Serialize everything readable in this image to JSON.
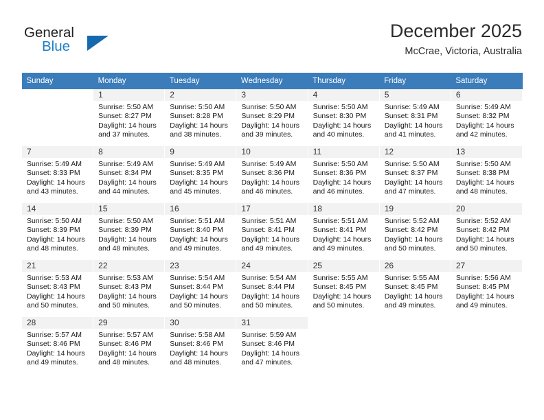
{
  "brand": {
    "name_part1": "General",
    "name_part2": "Blue",
    "triangle_color": "#1668b0",
    "blue_color": "#1d7fc4"
  },
  "header": {
    "month_title": "December 2025",
    "location": "McCrae, Victoria, Australia",
    "header_bg": "#3b7cba"
  },
  "calendar": {
    "weekday_headers": [
      "Sunday",
      "Monday",
      "Tuesday",
      "Wednesday",
      "Thursday",
      "Friday",
      "Saturday"
    ],
    "weeks": [
      [
        {
          "day": "",
          "blank": true,
          "sunrise": "",
          "sunset": "",
          "daylight1": "",
          "daylight2": ""
        },
        {
          "day": "1",
          "sunrise": "Sunrise: 5:50 AM",
          "sunset": "Sunset: 8:27 PM",
          "daylight1": "Daylight: 14 hours",
          "daylight2": "and 37 minutes."
        },
        {
          "day": "2",
          "sunrise": "Sunrise: 5:50 AM",
          "sunset": "Sunset: 8:28 PM",
          "daylight1": "Daylight: 14 hours",
          "daylight2": "and 38 minutes."
        },
        {
          "day": "3",
          "sunrise": "Sunrise: 5:50 AM",
          "sunset": "Sunset: 8:29 PM",
          "daylight1": "Daylight: 14 hours",
          "daylight2": "and 39 minutes."
        },
        {
          "day": "4",
          "sunrise": "Sunrise: 5:50 AM",
          "sunset": "Sunset: 8:30 PM",
          "daylight1": "Daylight: 14 hours",
          "daylight2": "and 40 minutes."
        },
        {
          "day": "5",
          "sunrise": "Sunrise: 5:49 AM",
          "sunset": "Sunset: 8:31 PM",
          "daylight1": "Daylight: 14 hours",
          "daylight2": "and 41 minutes."
        },
        {
          "day": "6",
          "sunrise": "Sunrise: 5:49 AM",
          "sunset": "Sunset: 8:32 PM",
          "daylight1": "Daylight: 14 hours",
          "daylight2": "and 42 minutes."
        }
      ],
      [
        {
          "day": "7",
          "sunrise": "Sunrise: 5:49 AM",
          "sunset": "Sunset: 8:33 PM",
          "daylight1": "Daylight: 14 hours",
          "daylight2": "and 43 minutes."
        },
        {
          "day": "8",
          "sunrise": "Sunrise: 5:49 AM",
          "sunset": "Sunset: 8:34 PM",
          "daylight1": "Daylight: 14 hours",
          "daylight2": "and 44 minutes."
        },
        {
          "day": "9",
          "sunrise": "Sunrise: 5:49 AM",
          "sunset": "Sunset: 8:35 PM",
          "daylight1": "Daylight: 14 hours",
          "daylight2": "and 45 minutes."
        },
        {
          "day": "10",
          "sunrise": "Sunrise: 5:49 AM",
          "sunset": "Sunset: 8:36 PM",
          "daylight1": "Daylight: 14 hours",
          "daylight2": "and 46 minutes."
        },
        {
          "day": "11",
          "sunrise": "Sunrise: 5:50 AM",
          "sunset": "Sunset: 8:36 PM",
          "daylight1": "Daylight: 14 hours",
          "daylight2": "and 46 minutes."
        },
        {
          "day": "12",
          "sunrise": "Sunrise: 5:50 AM",
          "sunset": "Sunset: 8:37 PM",
          "daylight1": "Daylight: 14 hours",
          "daylight2": "and 47 minutes."
        },
        {
          "day": "13",
          "sunrise": "Sunrise: 5:50 AM",
          "sunset": "Sunset: 8:38 PM",
          "daylight1": "Daylight: 14 hours",
          "daylight2": "and 48 minutes."
        }
      ],
      [
        {
          "day": "14",
          "sunrise": "Sunrise: 5:50 AM",
          "sunset": "Sunset: 8:39 PM",
          "daylight1": "Daylight: 14 hours",
          "daylight2": "and 48 minutes."
        },
        {
          "day": "15",
          "sunrise": "Sunrise: 5:50 AM",
          "sunset": "Sunset: 8:39 PM",
          "daylight1": "Daylight: 14 hours",
          "daylight2": "and 48 minutes."
        },
        {
          "day": "16",
          "sunrise": "Sunrise: 5:51 AM",
          "sunset": "Sunset: 8:40 PM",
          "daylight1": "Daylight: 14 hours",
          "daylight2": "and 49 minutes."
        },
        {
          "day": "17",
          "sunrise": "Sunrise: 5:51 AM",
          "sunset": "Sunset: 8:41 PM",
          "daylight1": "Daylight: 14 hours",
          "daylight2": "and 49 minutes."
        },
        {
          "day": "18",
          "sunrise": "Sunrise: 5:51 AM",
          "sunset": "Sunset: 8:41 PM",
          "daylight1": "Daylight: 14 hours",
          "daylight2": "and 49 minutes."
        },
        {
          "day": "19",
          "sunrise": "Sunrise: 5:52 AM",
          "sunset": "Sunset: 8:42 PM",
          "daylight1": "Daylight: 14 hours",
          "daylight2": "and 50 minutes."
        },
        {
          "day": "20",
          "sunrise": "Sunrise: 5:52 AM",
          "sunset": "Sunset: 8:42 PM",
          "daylight1": "Daylight: 14 hours",
          "daylight2": "and 50 minutes."
        }
      ],
      [
        {
          "day": "21",
          "sunrise": "Sunrise: 5:53 AM",
          "sunset": "Sunset: 8:43 PM",
          "daylight1": "Daylight: 14 hours",
          "daylight2": "and 50 minutes."
        },
        {
          "day": "22",
          "sunrise": "Sunrise: 5:53 AM",
          "sunset": "Sunset: 8:43 PM",
          "daylight1": "Daylight: 14 hours",
          "daylight2": "and 50 minutes."
        },
        {
          "day": "23",
          "sunrise": "Sunrise: 5:54 AM",
          "sunset": "Sunset: 8:44 PM",
          "daylight1": "Daylight: 14 hours",
          "daylight2": "and 50 minutes."
        },
        {
          "day": "24",
          "sunrise": "Sunrise: 5:54 AM",
          "sunset": "Sunset: 8:44 PM",
          "daylight1": "Daylight: 14 hours",
          "daylight2": "and 50 minutes."
        },
        {
          "day": "25",
          "sunrise": "Sunrise: 5:55 AM",
          "sunset": "Sunset: 8:45 PM",
          "daylight1": "Daylight: 14 hours",
          "daylight2": "and 50 minutes."
        },
        {
          "day": "26",
          "sunrise": "Sunrise: 5:55 AM",
          "sunset": "Sunset: 8:45 PM",
          "daylight1": "Daylight: 14 hours",
          "daylight2": "and 49 minutes."
        },
        {
          "day": "27",
          "sunrise": "Sunrise: 5:56 AM",
          "sunset": "Sunset: 8:45 PM",
          "daylight1": "Daylight: 14 hours",
          "daylight2": "and 49 minutes."
        }
      ],
      [
        {
          "day": "28",
          "sunrise": "Sunrise: 5:57 AM",
          "sunset": "Sunset: 8:46 PM",
          "daylight1": "Daylight: 14 hours",
          "daylight2": "and 49 minutes."
        },
        {
          "day": "29",
          "sunrise": "Sunrise: 5:57 AM",
          "sunset": "Sunset: 8:46 PM",
          "daylight1": "Daylight: 14 hours",
          "daylight2": "and 48 minutes."
        },
        {
          "day": "30",
          "sunrise": "Sunrise: 5:58 AM",
          "sunset": "Sunset: 8:46 PM",
          "daylight1": "Daylight: 14 hours",
          "daylight2": "and 48 minutes."
        },
        {
          "day": "31",
          "sunrise": "Sunrise: 5:59 AM",
          "sunset": "Sunset: 8:46 PM",
          "daylight1": "Daylight: 14 hours",
          "daylight2": "and 47 minutes."
        },
        {
          "day": "",
          "blank": true,
          "sunrise": "",
          "sunset": "",
          "daylight1": "",
          "daylight2": ""
        },
        {
          "day": "",
          "blank": true,
          "sunrise": "",
          "sunset": "",
          "daylight1": "",
          "daylight2": ""
        },
        {
          "day": "",
          "blank": true,
          "sunrise": "",
          "sunset": "",
          "daylight1": "",
          "daylight2": ""
        }
      ]
    ]
  }
}
